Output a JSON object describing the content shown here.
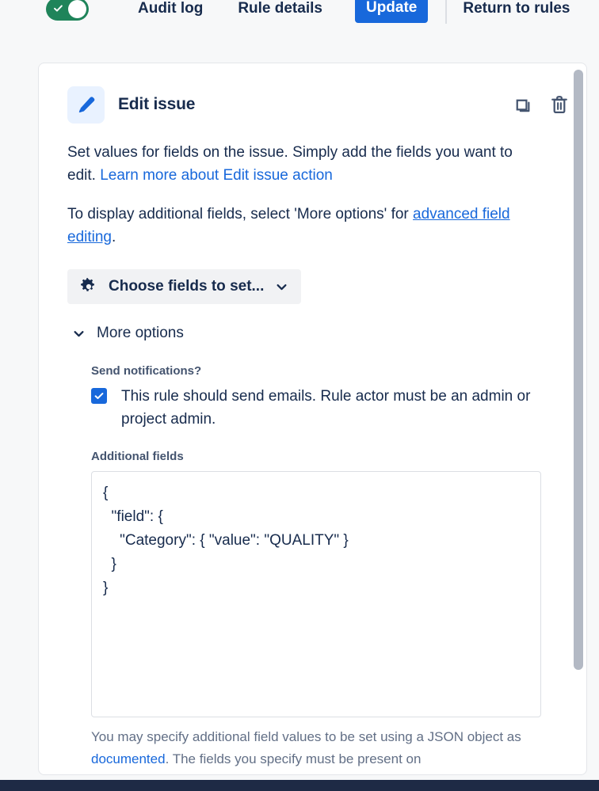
{
  "topnav": {
    "toggle": {
      "state": "on",
      "icon": "check-icon"
    },
    "links": [
      {
        "label": "Audit log"
      },
      {
        "label": "Rule details"
      }
    ],
    "update_label": "Update",
    "return_label": "Return to rules"
  },
  "card": {
    "icon": "pencil-icon",
    "title": "Edit issue",
    "actions": {
      "duplicate": "copy-icon",
      "delete": "trash-icon"
    },
    "paragraph1": {
      "before": "Set values for fields on the issue. Simply add the fields you want to edit. ",
      "link": "Learn more about Edit issue action"
    },
    "paragraph2": {
      "before": "To display additional fields, select 'More options' for ",
      "link": "advanced field editing",
      "after": "."
    },
    "choose_fields": {
      "icon": "gear-icon",
      "label": "Choose fields to set...",
      "chevron": "chevron-down-icon"
    },
    "more_options": {
      "chevron": "chevron-down-icon",
      "label": "More options",
      "expanded": true
    },
    "send_notifications": {
      "label": "Send notifications?",
      "checkbox_checked": true,
      "checkbox_label": "This rule should send emails. Rule actor must be an admin or project admin."
    },
    "additional_fields": {
      "label": "Additional fields",
      "value": "{\n  \"field\": {\n    \"Category\": { \"value\": \"QUALITY\" }\n  }\n}",
      "placeholder": "",
      "help_before": "You may specify additional field values to be set using a JSON object as ",
      "help_link": "documented",
      "help_after": ". The fields you specify must be present on"
    }
  },
  "colors": {
    "accent_blue": "#1868db",
    "toggle_green": "#1f845a",
    "text_dark": "#172b4d",
    "text_muted": "#626f86",
    "page_bg": "#f7f8f9",
    "card_bg": "#ffffff",
    "bottom_bar": "#1e2a45"
  }
}
